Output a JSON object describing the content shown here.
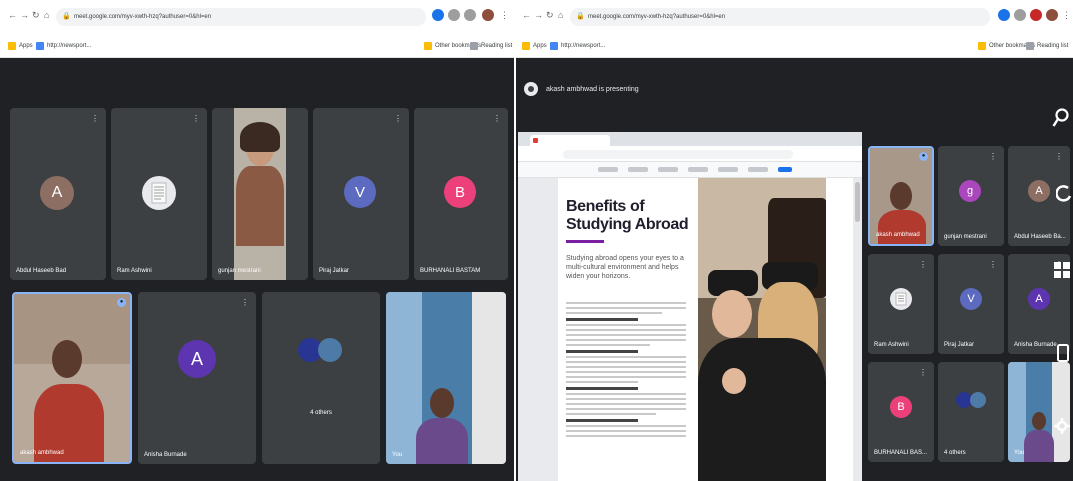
{
  "left_window": {
    "browser": {
      "url": "meet.google.com/myv-xwth-hzq?authuser=0&hl=en",
      "bookmarks": [
        "Apps",
        "http://newsport..."
      ],
      "bookmarks_right": [
        "Other bookmarks",
        "Reading list"
      ]
    },
    "tiles": [
      {
        "name": "Abdul Haseeb Bad",
        "initial": "A",
        "color": "#8d6e63"
      },
      {
        "name": "Ram Ashwini",
        "initial": "",
        "color": "#e8eaed"
      },
      {
        "name": "gunjan mestrani",
        "initial": "",
        "color": ""
      },
      {
        "name": "Piraj Jatkar",
        "initial": "V",
        "color": "#5c6bc0"
      },
      {
        "name": "BURHANALI BASTAM",
        "initial": "B",
        "color": "#ec407a"
      },
      {
        "name": "akash ambhwad",
        "initial": "",
        "color": ""
      },
      {
        "name": "Anisha Burnade",
        "initial": "A",
        "color": "#5e35b1"
      },
      {
        "name": "4 others",
        "initial": "",
        "color": ""
      },
      {
        "name": "You",
        "initial": "",
        "color": ""
      }
    ]
  },
  "right_window": {
    "browser": {
      "url": "meet.google.com/myv-xwth-hzq?authuser=0&hl=en",
      "bookmarks": [
        "Apps",
        "http://newsport..."
      ],
      "bookmarks_right": [
        "Other bookmarks",
        "Reading list"
      ]
    },
    "presenting_text": "akash ambhwad is presenting",
    "shared_doc": {
      "title": "Benefits of Studying Abroad",
      "subtitle": "Studying abroad opens your eyes to a multi-cultural environment and helps widen your horizons."
    },
    "tiles": [
      {
        "name": "akash ambhwad",
        "initial": "",
        "color": ""
      },
      {
        "name": "gunjan mestrani",
        "initial": "g",
        "color": "#ab47bc"
      },
      {
        "name": "Abdul Haseeb Ba...",
        "initial": "A",
        "color": "#8d6e63"
      },
      {
        "name": "Ram Ashwini",
        "initial": "",
        "color": "#e8eaed"
      },
      {
        "name": "Piraj Jatkar",
        "initial": "V",
        "color": "#5c6bc0"
      },
      {
        "name": "Anisha Burnade",
        "initial": "A",
        "color": "#5e35b1"
      },
      {
        "name": "BURHANALI BAS...",
        "initial": "B",
        "color": "#ec407a"
      },
      {
        "name": "4 others",
        "initial": "",
        "color": ""
      },
      {
        "name": "You",
        "initial": "",
        "color": ""
      }
    ]
  }
}
